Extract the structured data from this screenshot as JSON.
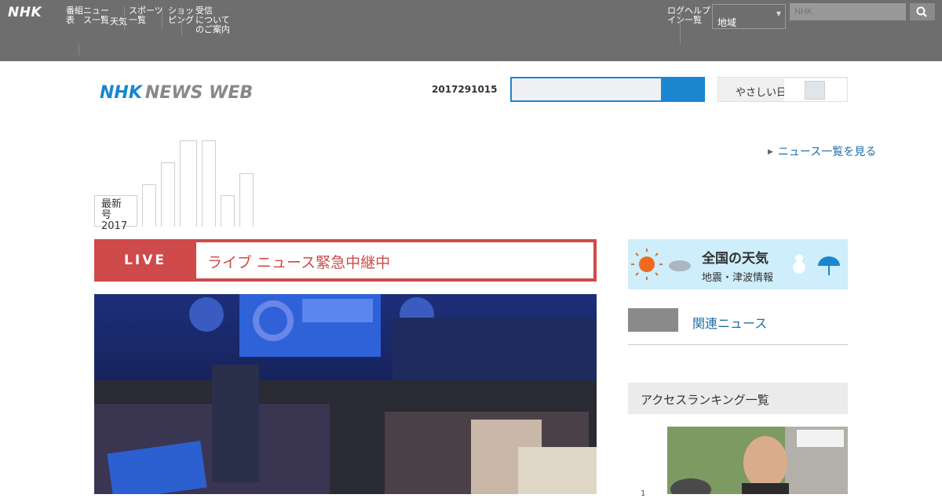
{
  "topbar": {
    "logo": "NHK",
    "nav": [
      {
        "label": "番組\n表"
      },
      {
        "label": "ニュー\nス一覧"
      },
      {
        "label": "天気"
      },
      {
        "label": "スポーツ\n一覧"
      },
      {
        "label": "ショッ\nピング"
      },
      {
        "label": "受信\nについて\nのご案内"
      }
    ],
    "right_nav": [
      {
        "label": "ログ\nイン"
      },
      {
        "label": "ヘルプ\n一覧"
      }
    ],
    "select_value": "地域",
    "search_placeholder": "NHK"
  },
  "header": {
    "logo_nhk": "NHK",
    "logo_newsweb": "NEWS WEB",
    "date": "2017291015",
    "search_placeholder": "",
    "lang_label": "やさしい日本",
    "lang_switch_state": "off"
  },
  "date_tabs": {
    "year_label": "最新号",
    "year": "2017"
  },
  "side_link": "ニュース一覧を見る",
  "live": {
    "badge": "LIVE",
    "title": "ライブ ニュース緊急中継中"
  },
  "weather": {
    "line1": "全国の天気",
    "line2": "地震・津波情報"
  },
  "related": {
    "text": "関連ニュース"
  },
  "ranking": {
    "title": "アクセスランキング一覧",
    "rank_first": "1"
  },
  "colors": {
    "accent_blue": "#1a86d0",
    "live_red": "#cf4a4a",
    "topbar_gray": "#6e6e6e",
    "link_blue": "#1a6fa8"
  }
}
